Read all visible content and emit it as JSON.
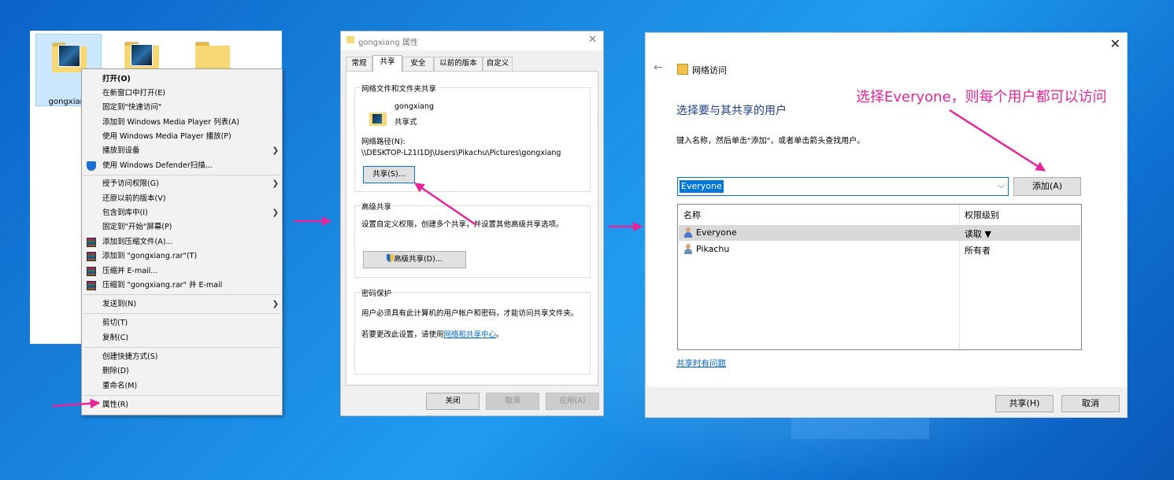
{
  "explorer": {
    "files": [
      {
        "label": "gongxiang",
        "type": "folder-photo",
        "selected": true
      },
      {
        "label": "",
        "type": "folder-photo",
        "selected": false
      },
      {
        "label": "",
        "type": "folder",
        "selected": false
      }
    ]
  },
  "context_menu": {
    "items": [
      {
        "label": "打开(O)",
        "bold": true
      },
      {
        "label": "在新窗口中打开(E)"
      },
      {
        "label": "固定到\"快速访问\""
      },
      {
        "label": "添加到 Windows Media Player 列表(A)"
      },
      {
        "label": "使用 Windows Media Player 播放(P)"
      },
      {
        "label": "播放到设备",
        "submenu": true
      },
      {
        "label": "使用 Windows Defender扫描...",
        "icon": "defender-shield-icon"
      },
      {
        "label": "授予访问权限(G)",
        "submenu": true
      },
      {
        "label": "还原以前的版本(V)"
      },
      {
        "label": "包含到库中(I)",
        "submenu": true
      },
      {
        "label": "固定到\"开始\"屏幕(P)"
      },
      {
        "label": "添加到压缩文件(A)...",
        "icon": "winrar-icon"
      },
      {
        "label": "添加到 \"gongxiang.rar\"(T)",
        "icon": "winrar-icon"
      },
      {
        "label": "压缩并 E-mail...",
        "icon": "winrar-icon"
      },
      {
        "label": "压缩到 \"gongxiang.rar\" 并 E-mail",
        "icon": "winrar-icon"
      },
      {
        "label": "发送到(N)",
        "submenu": true
      },
      {
        "label": "剪切(T)"
      },
      {
        "label": "复制(C)"
      },
      {
        "label": "创建快捷方式(S)"
      },
      {
        "label": "删除(D)"
      },
      {
        "label": "重命名(M)"
      },
      {
        "label": "属性(R)"
      }
    ]
  },
  "properties": {
    "title": "gongxiang 属性",
    "tabs": [
      "常规",
      "共享",
      "安全",
      "以前的版本",
      "自定义"
    ],
    "active_tab": "共享",
    "network_sharing": {
      "group_title": "网络文件和文件夹共享",
      "folder_name": "gongxiang",
      "folder_status": "共享式",
      "path_label": "网络路径(N):",
      "path_value": "\\\\DESKTOP-L21I1DJ\\Users\\Pikachu\\Pictures\\gongxiang",
      "share_button": "共享(S)..."
    },
    "advanced_sharing": {
      "group_title": "高级共享",
      "description": "设置自定义权限，创建多个共享，并设置其他高级共享选项。",
      "button": "高级共享(D)..."
    },
    "password_protection": {
      "group_title": "密码保护",
      "description": "用户必须具有此计算机的用户帐户和密码，才能访问共享文件夹。",
      "change_prefix": "若要更改此设置，请使用",
      "change_link": "网络和共享中心",
      "change_suffix": "。"
    },
    "buttons": {
      "close": "关闭",
      "cancel": "取消",
      "apply": "应用(A)"
    }
  },
  "network_access": {
    "title": "网络访问",
    "heading": "选择要与其共享的用户",
    "instructions": "键入名称，然后单击\"添加\"，或者单击箭头查找用户。",
    "input_value": "Everyone",
    "add_button": "添加(A)",
    "columns": {
      "name": "名称",
      "permission": "权限级别"
    },
    "rows": [
      {
        "name": "Everyone",
        "permission": "读取 ▼",
        "selected": true
      },
      {
        "name": "Pikachu",
        "permission": "所有者",
        "selected": false
      }
    ],
    "help_link": "共享时有问题",
    "buttons": {
      "share": "共享(H)",
      "cancel": "取消"
    }
  },
  "annotation": {
    "text": "选择Everyone，则每个用户都可以访问",
    "color": "#e6259a"
  },
  "colors": {
    "accent": "#0078d7",
    "arrow": "#e6259a",
    "link": "#0066cc"
  }
}
